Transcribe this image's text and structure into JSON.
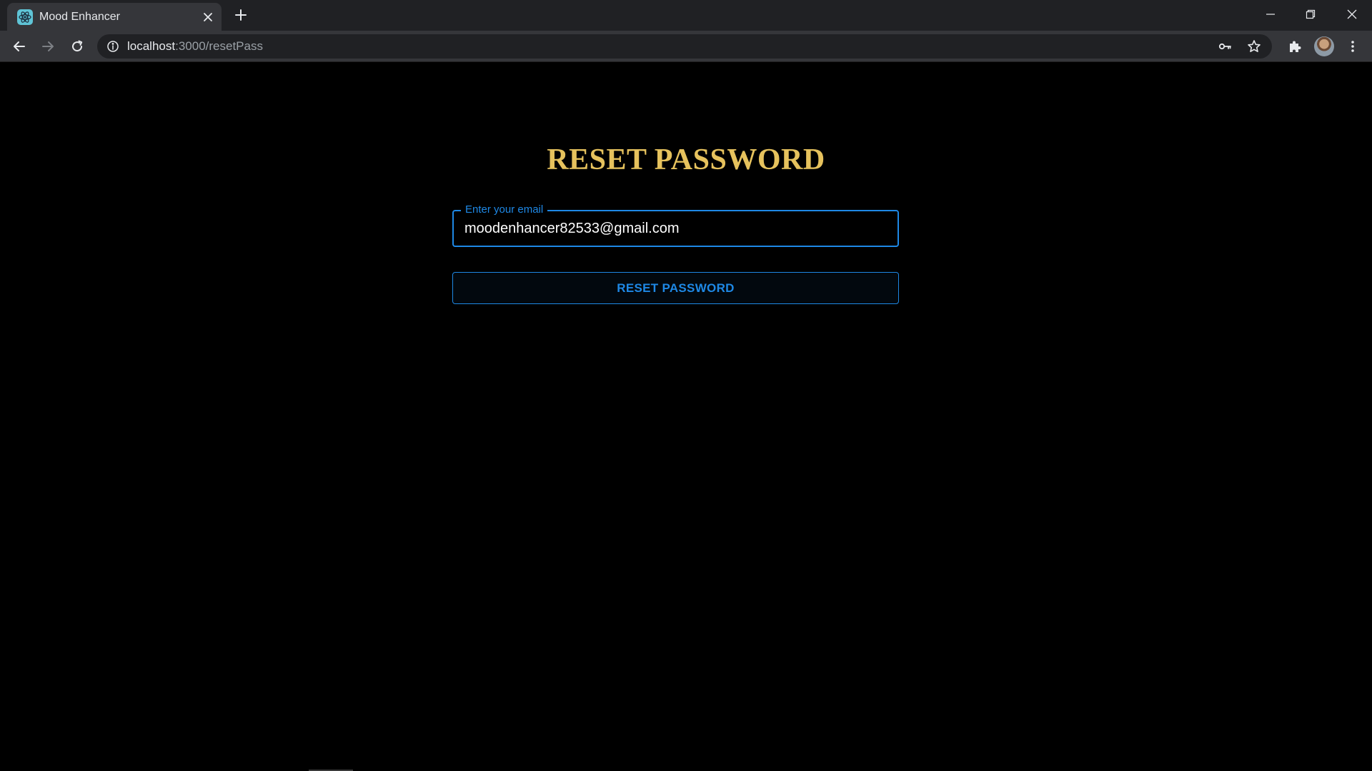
{
  "browser": {
    "tab_title": "Mood Enhancer",
    "url_host": "localhost",
    "url_path": ":3000/resetPass",
    "icons": {
      "favicon": "react-logo-icon",
      "tab_close": "close-icon",
      "new_tab": "plus-icon",
      "back": "arrow-left-icon",
      "forward": "arrow-right-icon",
      "reload": "reload-icon",
      "site_info": "info-icon",
      "password_key": "key-icon",
      "bookmark": "star-icon",
      "extensions": "puzzle-icon",
      "menu": "kebab-menu-icon"
    }
  },
  "page": {
    "title": "RESET PASSWORD",
    "email_field": {
      "label": "Enter your email",
      "value": "moodenhancer82533@gmail.com"
    },
    "reset_button_label": "RESET PASSWORD"
  },
  "colors": {
    "background": "#000000",
    "title": "#e6c25d",
    "accent": "#1e88e5",
    "chrome_frame": "#202124",
    "chrome_toolbar": "#35363a"
  }
}
